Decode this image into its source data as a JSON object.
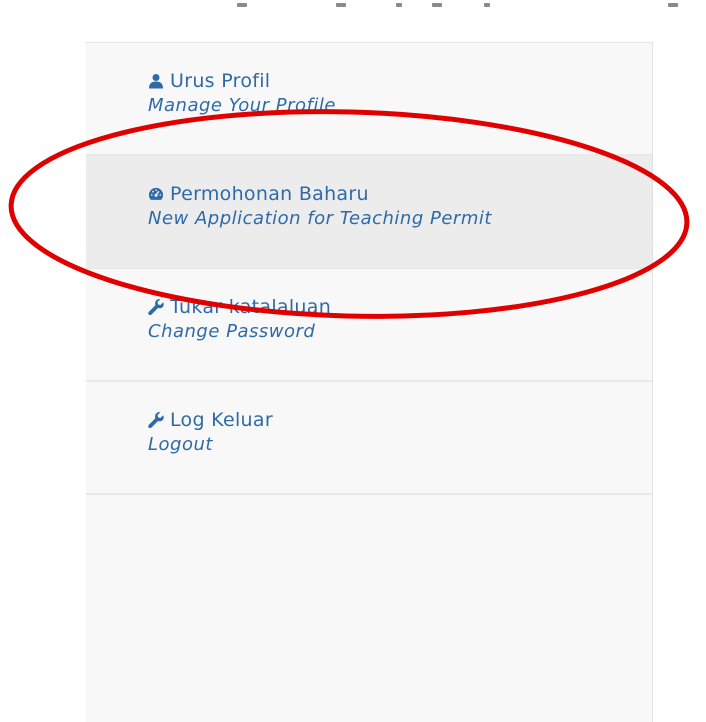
{
  "sidebar": {
    "items": [
      {
        "label": "Urus Profil",
        "sublabel": "Manage Your Profile",
        "icon": "user-icon"
      },
      {
        "label": "Permohonan Baharu",
        "sublabel": "New Application for Teaching Permit",
        "icon": "dashboard-icon"
      },
      {
        "label": "Tukar katalaluan",
        "sublabel": "Change Password",
        "icon": "wrench-icon"
      },
      {
        "label": "Log Keluar",
        "sublabel": "Logout",
        "icon": "wrench-icon"
      }
    ]
  },
  "colors": {
    "link": "#2f6aa8",
    "annotation": "#e00000",
    "active_bg": "#ececec",
    "sidebar_bg": "#f8f8f8"
  }
}
